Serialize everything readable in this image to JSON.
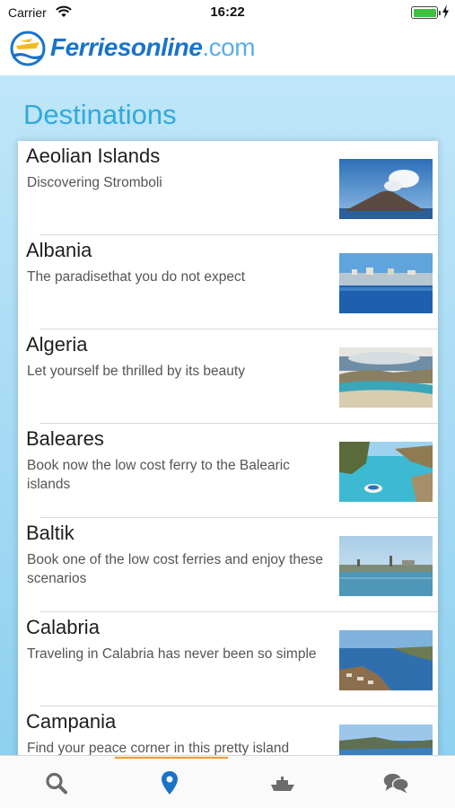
{
  "status_bar": {
    "carrier": "Carrier",
    "time": "16:22",
    "battery_level": 1.0
  },
  "header": {
    "logo_bold": "Ferriesonline",
    "logo_light": ".com",
    "brand_color": "#1a73c8"
  },
  "page": {
    "title": "Destinations"
  },
  "destinations": [
    {
      "title": "Aeolian Islands",
      "desc": "Discovering Stromboli",
      "image": "volcano-island-photo"
    },
    {
      "title": "Albania",
      "desc": "The paradisethat you do not expect",
      "image": "coastal-town-photo"
    },
    {
      "title": "Algeria",
      "desc": "Let yourself be thrilled by its beauty",
      "image": "bay-beach-photo"
    },
    {
      "title": "Baleares",
      "desc": "Book now the low cost ferry to the Balearic islands",
      "image": "cove-boat-photo"
    },
    {
      "title": "Baltik",
      "desc": "Book one of the low cost ferries and enjoy these scenarios",
      "image": "harbor-city-photo"
    },
    {
      "title": "Calabria",
      "desc": "Traveling in Calabria has never been so simple",
      "image": "cliff-coast-photo"
    },
    {
      "title": "Campania",
      "desc": "Find your peace corner in this pretty island",
      "image": "island-coast-photo"
    }
  ],
  "tabs": [
    {
      "name": "search",
      "icon": "search-icon",
      "active": false
    },
    {
      "name": "destinations",
      "icon": "location-pin-icon",
      "active": true
    },
    {
      "name": "ferries",
      "icon": "ship-icon",
      "active": false
    },
    {
      "name": "chat",
      "icon": "chat-bubbles-icon",
      "active": false
    }
  ],
  "colors": {
    "accent": "#2eaadf",
    "active_tab": "#1a73c8",
    "inactive_tab": "#6b6b6b",
    "indicator": "#f39a1f"
  }
}
